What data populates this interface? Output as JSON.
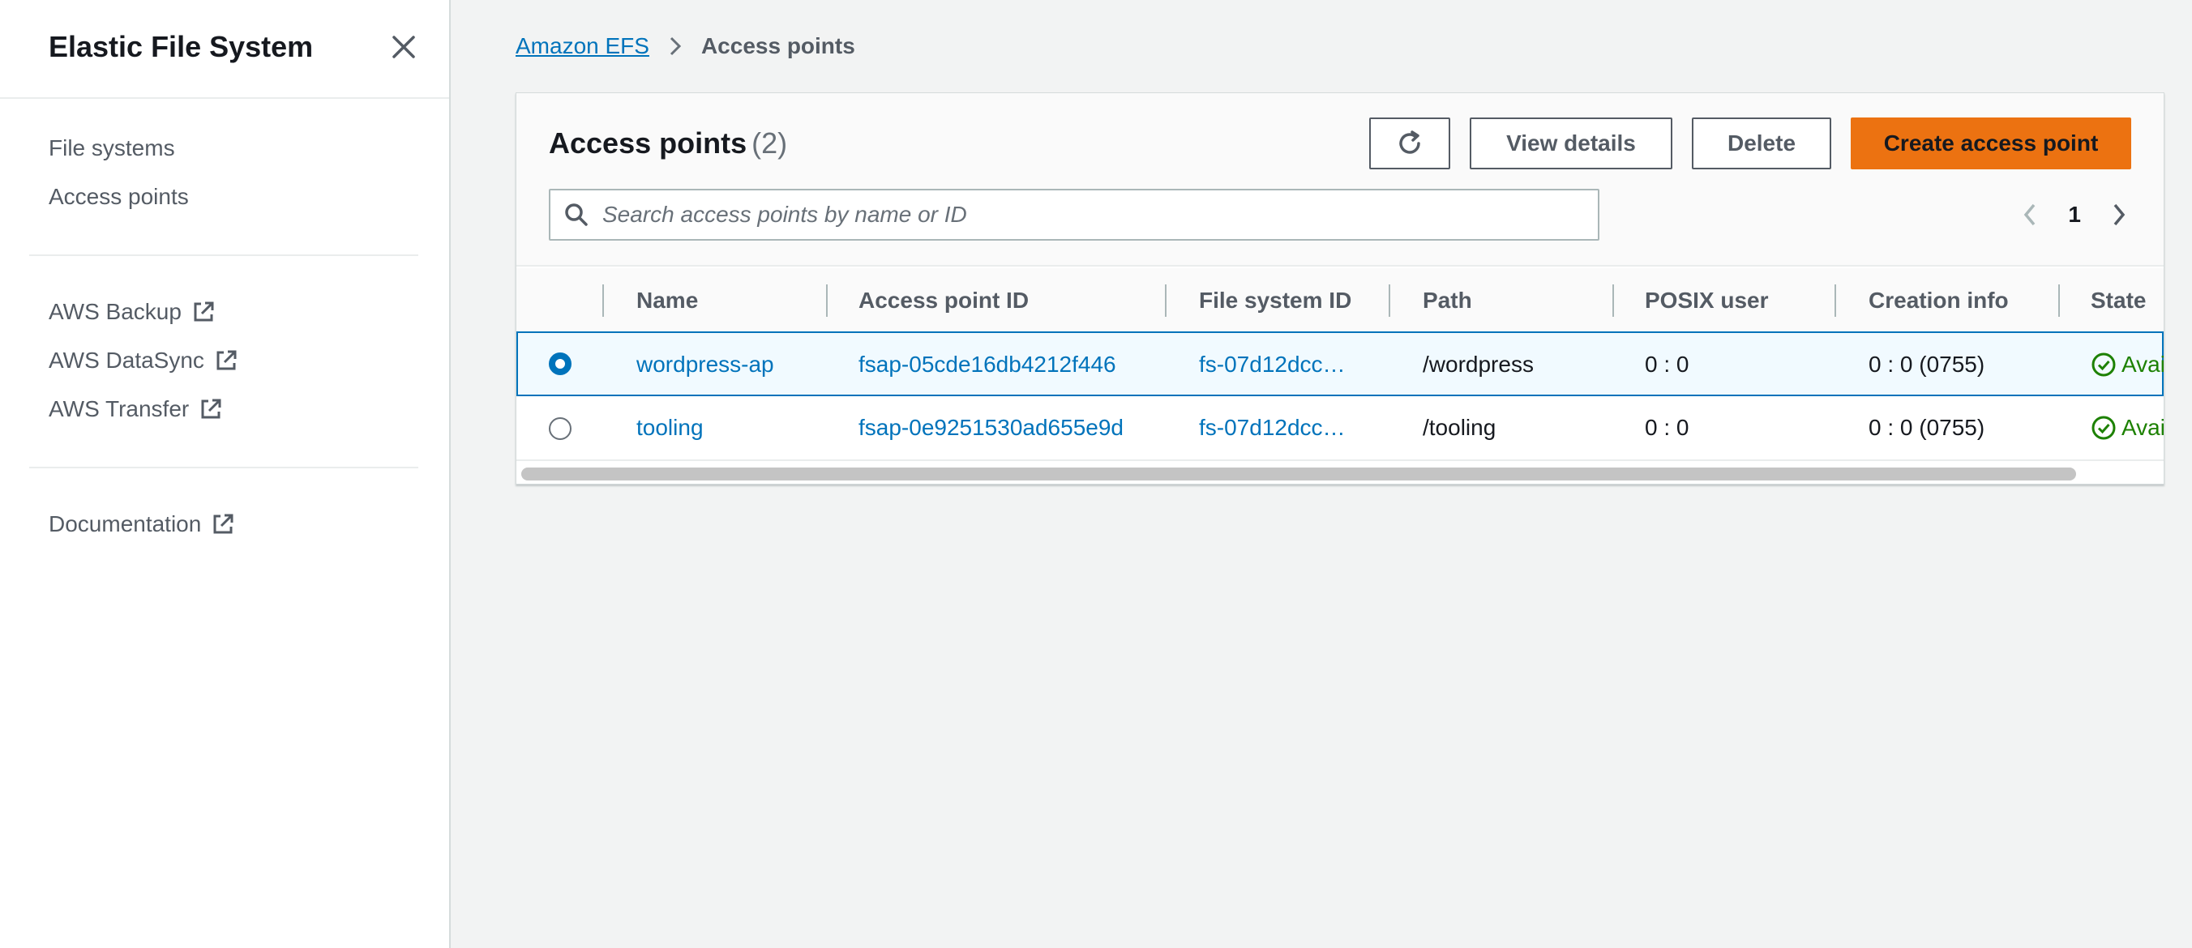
{
  "sidebar": {
    "title": "Elastic File System",
    "nav_primary": [
      {
        "label": "File systems"
      },
      {
        "label": "Access points"
      }
    ],
    "nav_external": [
      {
        "label": "AWS Backup"
      },
      {
        "label": "AWS DataSync"
      },
      {
        "label": "AWS Transfer"
      }
    ],
    "documentation": {
      "label": "Documentation"
    }
  },
  "breadcrumb": {
    "root": "Amazon EFS",
    "current": "Access points"
  },
  "panel": {
    "title": "Access points",
    "count": "(2)",
    "buttons": {
      "view_details": "View details",
      "delete": "Delete",
      "create": "Create access point"
    },
    "search": {
      "placeholder": "Search access points by name or ID"
    },
    "pagination": {
      "page": "1"
    }
  },
  "table": {
    "columns": [
      "Name",
      "Access point ID",
      "File system ID",
      "Path",
      "POSIX user",
      "Creation info",
      "State"
    ],
    "rows": [
      {
        "selected": true,
        "name": "wordpress-ap",
        "id": "fsap-05cde16db4212f446",
        "fs": "fs-07d12dcc…",
        "path": "/wordpress",
        "posix": "0 : 0",
        "creation": "0 : 0 (0755)",
        "state": "Avai"
      },
      {
        "selected": false,
        "name": "tooling",
        "id": "fsap-0e9251530ad655e9d",
        "fs": "fs-07d12dcc…",
        "path": "/tooling",
        "posix": "0 : 0",
        "creation": "0 : 0 (0755)",
        "state": "Avai"
      }
    ]
  },
  "colors": {
    "primary": "#ec7211",
    "link": "#0073bb",
    "success": "#1d8102"
  }
}
